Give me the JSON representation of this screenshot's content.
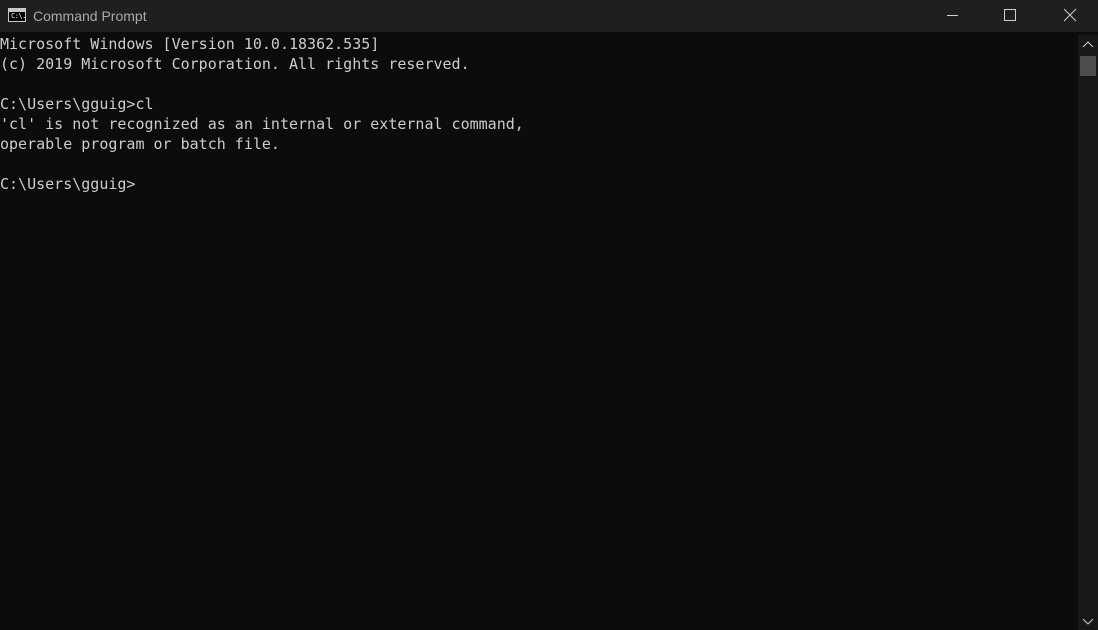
{
  "window": {
    "title": "Command Prompt",
    "icon": "cmd-icon",
    "icon_glyph": "C:\\."
  },
  "titlebar_buttons": {
    "minimize_icon": "minimize-icon",
    "maximize_icon": "maximize-icon",
    "close_icon": "close-icon"
  },
  "console": {
    "lines": [
      "Microsoft Windows [Version 10.0.18362.535]",
      "(c) 2019 Microsoft Corporation. All rights reserved.",
      "",
      "C:\\Users\\gguig>cl",
      "'cl' is not recognized as an internal or external command,",
      "operable program or batch file.",
      "",
      "C:\\Users\\gguig>"
    ]
  },
  "colors": {
    "console_background": "#0c0c0c",
    "console_text": "#cccccc",
    "titlebar_background": "#1f1f1f",
    "title_text": "#a9a9a9",
    "scrollbar_track": "#171717",
    "scrollbar_thumb": "#4d4d4d"
  }
}
